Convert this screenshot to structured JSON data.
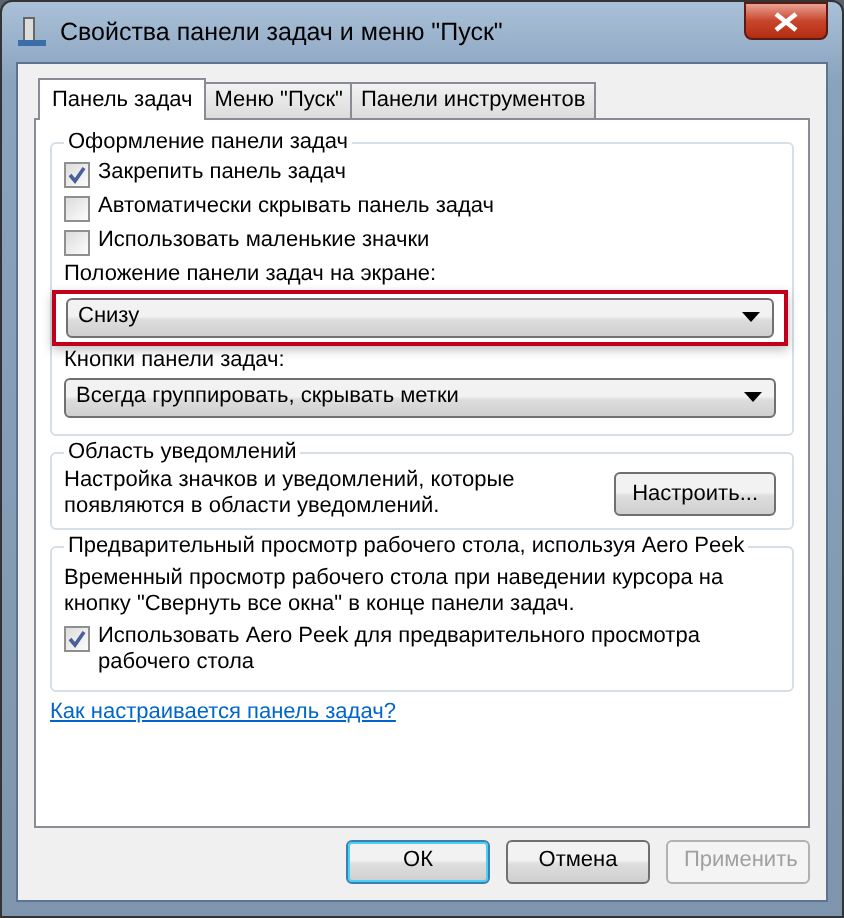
{
  "window": {
    "title": "Свойства панели задач и меню \"Пуск\""
  },
  "tabs": [
    {
      "label": "Панель задач",
      "selected": true
    },
    {
      "label": "Меню \"Пуск\"",
      "selected": false
    },
    {
      "label": "Панели инструментов",
      "selected": false
    }
  ],
  "groups": [
    {
      "legend": "Оформление панели задач",
      "items": [
        {
          "kind": "checkbox",
          "label": "Закрепить панель задач",
          "checked": true
        },
        {
          "kind": "checkbox",
          "label": "Автоматически скрывать панель задач",
          "checked": false
        },
        {
          "kind": "checkbox",
          "label": "Использовать маленькие значки",
          "checked": false
        },
        {
          "kind": "label",
          "label": "Положение панели задач на экране:"
        },
        {
          "kind": "dropdown",
          "value": "Снизу",
          "highlighted": true
        },
        {
          "kind": "label",
          "label": "Кнопки панели задач:"
        },
        {
          "kind": "dropdown",
          "value": "Всегда группировать, скрывать метки",
          "highlighted": false
        }
      ]
    },
    {
      "legend": "Область уведомлений",
      "items": [
        {
          "kind": "text_button",
          "text": "Настройка значков и уведомлений, которые появляются в области уведомлений.",
          "button": "Настроить..."
        }
      ]
    },
    {
      "legend": "Предварительный просмотр рабочего стола, используя Aero Peek",
      "items": [
        {
          "kind": "text",
          "text": "Временный просмотр рабочего стола при наведении курсора на кнопку \"Свернуть все окна\" в конце панели задач."
        },
        {
          "kind": "checkbox",
          "label": "Использовать Aero Peek для предварительного просмотра рабочего стола",
          "checked": true
        }
      ]
    }
  ],
  "link": "Как настраивается панель задач?",
  "buttons": [
    {
      "label": "ОК",
      "default": true,
      "disabled": false
    },
    {
      "label": "Отмена",
      "default": false,
      "disabled": false
    },
    {
      "label": "Применить",
      "default": false,
      "disabled": true
    }
  ]
}
